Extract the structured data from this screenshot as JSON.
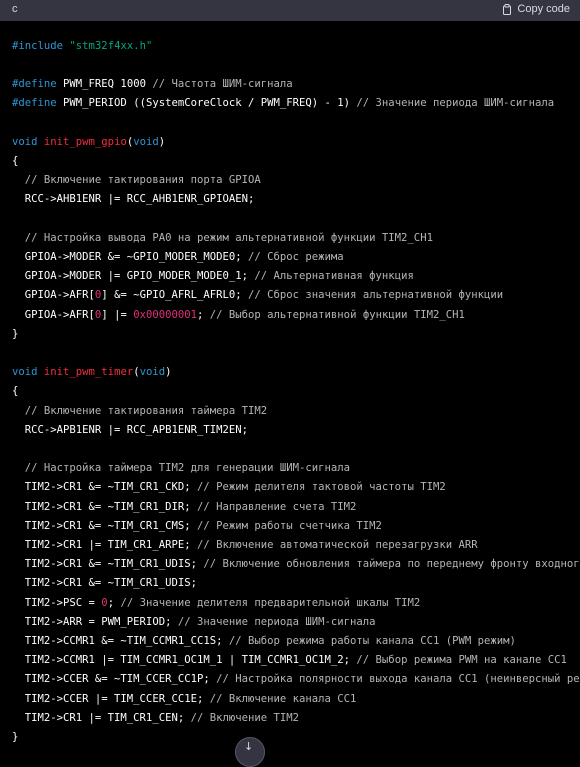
{
  "header": {
    "language": "c",
    "copy_label": "Copy code"
  },
  "code": {
    "l1": [
      "#include",
      " ",
      "\"stm32f4xx.h\""
    ],
    "l2": [
      "#define",
      " PWM_FREQ 1000 ",
      "// Частота ШИМ-сигнала"
    ],
    "l3": [
      "#define",
      " PWM_PERIOD ((SystemCoreClock / PWM_FREQ) - 1) ",
      "// Значение периода ШИМ-сигнала"
    ],
    "l4": [
      "void",
      " ",
      "init_pwm_gpio",
      "(",
      "void",
      ")"
    ],
    "l5": "{",
    "l6": "  // Включение тактирования порта GPIOA",
    "l7": "  RCC->AHB1ENR |= RCC_AHB1ENR_GPIOAEN;",
    "l8": "  // Настройка вывода PA0 на режим альтернативной функции TIM2_CH1",
    "l9": [
      "  GPIOA->MODER &= ~GPIO_MODER_MODE0; ",
      "// Сброс режима"
    ],
    "l10": [
      "  GPIOA->MODER |= GPIO_MODER_MODE0_1; ",
      "// Альтернативная функция"
    ],
    "l11": [
      "  GPIOA->AFR[",
      "0",
      "] &= ~GPIO_AFRL_AFRL0; ",
      "// Сброс значения альтернативной функции"
    ],
    "l12": [
      "  GPIOA->AFR[",
      "0",
      "] |= ",
      "0x00000001",
      "; ",
      "// Выбор альтернативной функции TIM2_CH1"
    ],
    "l13": "}",
    "l14": [
      "void",
      " ",
      "init_pwm_timer",
      "(",
      "void",
      ")"
    ],
    "l15": "{",
    "l16": "  // Включение тактирования таймера TIM2",
    "l17": "  RCC->APB1ENR |= RCC_APB1ENR_TIM2EN;",
    "l18": "  // Настройка таймера TIM2 для генерации ШИМ-сигнала",
    "l19": [
      "  TIM2->CR1 &= ~TIM_CR1_CKD; ",
      "// Режим делителя тактовой частоты TIM2"
    ],
    "l20": [
      "  TIM2->CR1 &= ~TIM_CR1_DIR; ",
      "// Направление счета TIM2"
    ],
    "l21": [
      "  TIM2->CR1 &= ~TIM_CR1_CMS; ",
      "// Режим работы счетчика TIM2"
    ],
    "l22": [
      "  TIM2->CR1 |= TIM_CR1_ARPE; ",
      "// Включение автоматической перезагрузки ARR"
    ],
    "l23": [
      "  TIM2->CR1 &= ~TIM_CR1_UDIS; ",
      "// Включение обновления таймера по переднему фронту входного"
    ],
    "l24": "  TIM2->CR1 &= ~TIM_CR1_UDIS;",
    "l25": [
      "  TIM2->PSC = ",
      "0",
      "; ",
      "// Значение делителя предварительной шкалы TIM2"
    ],
    "l26": [
      "  TIM2->ARR = PWM_PERIOD; ",
      "// Значение периода ШИМ-сигнала"
    ],
    "l27": [
      "  TIM2->CCMR1 &= ~TIM_CCMR1_CC1S; ",
      "// Выбор режима работы канала CC1 (PWM режим)"
    ],
    "l28": [
      "  TIM2->CCMR1 |= TIM_CCMR1_OC1M_1 | TIM_CCMR1_OC1M_2; ",
      "// Выбор режима PWM на канале CC1"
    ],
    "l29": [
      "  TIM2->CCER &= ~TIM_CCER_CC1P; ",
      "// Настройка полярности выхода канала CC1 (неинверсный ре"
    ],
    "l30": [
      "  TIM2->CCER |= TIM_CCER_CC1E; ",
      "// Включение канала CC1"
    ],
    "l31": [
      "  TIM2->CR1 |= TIM_CR1_CEN; ",
      "// Включение TIM2"
    ],
    "l32": "}"
  },
  "scroll_button": {
    "icon": "down-arrow-icon",
    "glyph": "↓"
  },
  "colors": {
    "header_bg": "#343541",
    "code_bg": "#000000",
    "keyword": "#2e95d3",
    "function": "#f22c3d",
    "comment": "#b5b5b5",
    "string": "#00a67d",
    "number": "#df3079"
  }
}
